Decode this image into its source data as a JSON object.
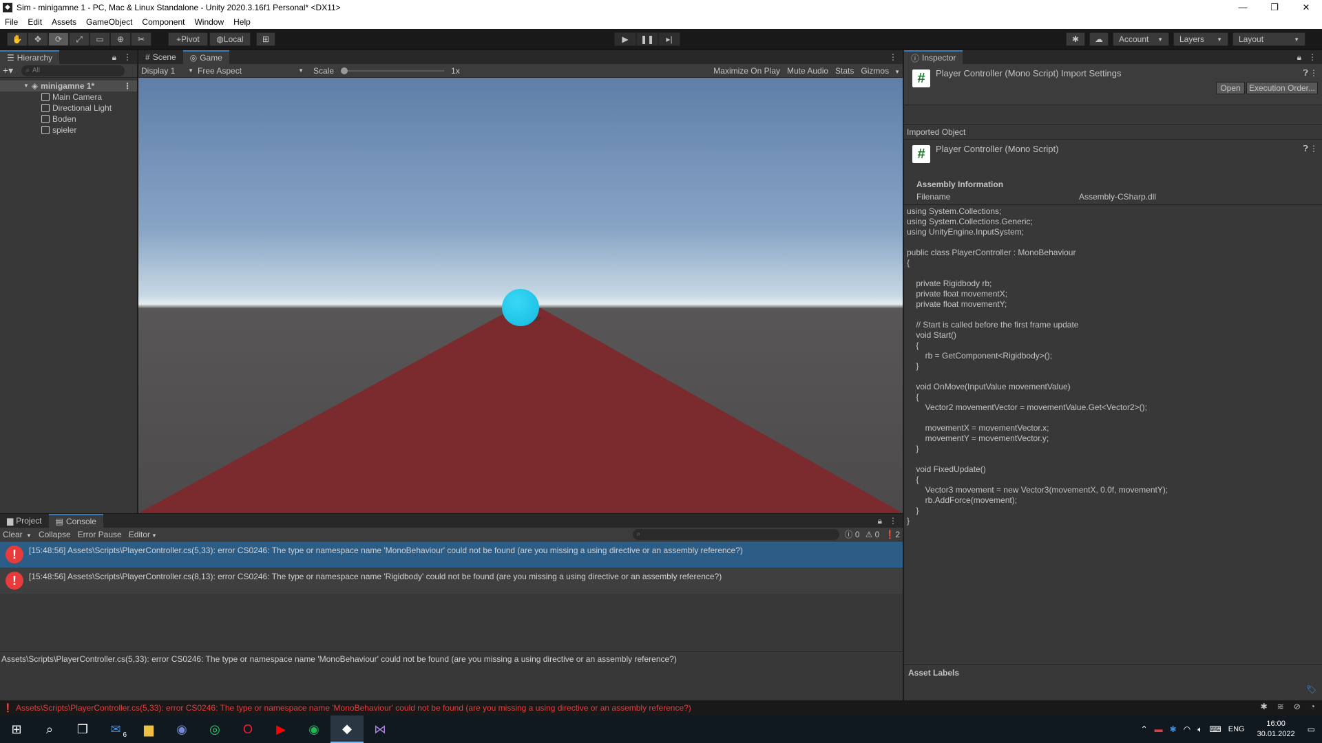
{
  "window": {
    "title": "Sim - minigamne 1 - PC, Mac & Linux Standalone - Unity 2020.3.16f1 Personal* <DX11>",
    "controls": [
      "—",
      "❐",
      "✕"
    ]
  },
  "menu": [
    "File",
    "Edit",
    "Assets",
    "GameObject",
    "Component",
    "Window",
    "Help"
  ],
  "toolbar": {
    "pivot": "Pivot",
    "local": "Local",
    "account": "Account",
    "layers": "Layers",
    "layout": "Layout"
  },
  "hierarchy": {
    "tab": "Hierarchy",
    "search_placeholder": "All",
    "scene": "minigamne 1*",
    "items": [
      "Main Camera",
      "Directional Light",
      "Boden",
      "spieler"
    ]
  },
  "game": {
    "tabs": [
      "Scene",
      "Game"
    ],
    "display": "Display 1",
    "aspect": "Free Aspect",
    "scale_label": "Scale",
    "scale_value": "1x",
    "scale_fraction": 0.0,
    "options": [
      "Maximize On Play",
      "Mute Audio",
      "Stats",
      "Gizmos"
    ],
    "colors": {
      "sphere": "#1ec1e6",
      "floor": "#7b2a2e"
    }
  },
  "inspector": {
    "tab": "Inspector",
    "header_title": "Player Controller (Mono Script) Import Settings",
    "open_label": "Open",
    "exec_label": "Execution Order...",
    "imported_object": "Imported Object",
    "script_title": "Player Controller (Mono Script)",
    "assembly_info": "Assembly Information",
    "filename_label": "Filename",
    "filename_value": "Assembly-CSharp.dll",
    "code": "using System.Collections;\nusing System.Collections.Generic;\nusing UnityEngine.InputSystem;\n\npublic class PlayerController : MonoBehaviour\n{\n\n    private Rigidbody rb;\n    private float movementX;\n    private float movementY;\n\n    // Start is called before the first frame update\n    void Start()\n    {\n        rb = GetComponent<Rigidbody>();\n    }\n\n    void OnMove(InputValue movementValue)\n    {\n        Vector2 movementVector = movementValue.Get<Vector2>();\n\n        movementX = movementVector.x;\n        movementY = movementVector.y;\n    }\n\n    void FixedUpdate()\n    {\n        Vector3 movement = new Vector3(movementX, 0.0f, movementY);\n        rb.AddForce(movement);\n    }\n}",
    "asset_labels": "Asset Labels"
  },
  "console": {
    "tabs": [
      "Project",
      "Console"
    ],
    "buttons": [
      "Clear",
      "Collapse",
      "Error Pause",
      "Editor"
    ],
    "counts": {
      "info": "0",
      "warn": "0",
      "error": "2"
    },
    "logs": [
      "[15:48:56] Assets\\Scripts\\PlayerController.cs(5,33): error CS0246: The type or namespace name 'MonoBehaviour' could not be found (are you missing a using directive or an assembly reference?)",
      "[15:48:56] Assets\\Scripts\\PlayerController.cs(8,13): error CS0246: The type or namespace name 'Rigidbody' could not be found (are you missing a using directive or an assembly reference?)"
    ],
    "detail": "Assets\\Scripts\\PlayerController.cs(5,33): error CS0246: The type or namespace name 'MonoBehaviour' could not be found (are you missing a using directive or an assembly reference?)"
  },
  "status": {
    "message": "Assets\\Scripts\\PlayerController.cs(5,33): error CS0246: The type or namespace name 'MonoBehaviour' could not be found (are you missing a using directive or an assembly reference?)"
  },
  "taskbar": {
    "mail_badge": "6",
    "lang": "ENG",
    "time": "16:00",
    "date": "30.01.2022"
  }
}
